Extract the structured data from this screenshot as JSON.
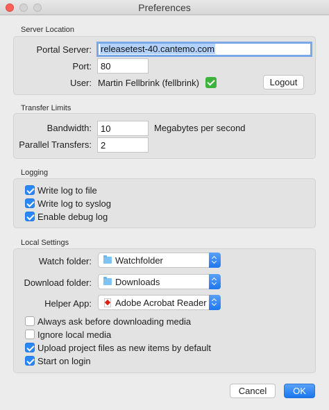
{
  "window": {
    "title": "Preferences"
  },
  "server": {
    "section_title": "Server Location",
    "portal_label": "Portal Server:",
    "portal_value": "releasetest-40.cantemo.com",
    "port_label": "Port:",
    "port_value": "80",
    "user_label": "User:",
    "user_value": "Martin Fellbrink (fellbrink)",
    "logout_label": "Logout"
  },
  "transfer": {
    "section_title": "Transfer Limits",
    "bandwidth_label": "Bandwidth:",
    "bandwidth_value": "10",
    "bandwidth_unit": "Megabytes per second",
    "parallel_label": "Parallel Transfers:",
    "parallel_value": "2"
  },
  "logging": {
    "section_title": "Logging",
    "items": [
      {
        "label": "Write log to file",
        "checked": true
      },
      {
        "label": "Write log to syslog",
        "checked": true
      },
      {
        "label": "Enable debug log",
        "checked": true
      }
    ]
  },
  "local": {
    "section_title": "Local Settings",
    "watch_label": "Watch folder:",
    "watch_value": "Watchfolder",
    "download_label": "Download folder:",
    "download_value": "Downloads",
    "helper_label": "Helper App:",
    "helper_value": "Adobe Acrobat Reader DC",
    "options": [
      {
        "label": "Always ask before downloading media",
        "checked": false
      },
      {
        "label": "Ignore local media",
        "checked": false
      },
      {
        "label": "Upload project files as new items by default",
        "checked": true
      },
      {
        "label": "Start on login",
        "checked": true
      }
    ]
  },
  "footer": {
    "cancel_label": "Cancel",
    "ok_label": "OK"
  },
  "colors": {
    "accent": "#2c87f6",
    "close": "#fc605b",
    "verified": "#3db23c"
  }
}
